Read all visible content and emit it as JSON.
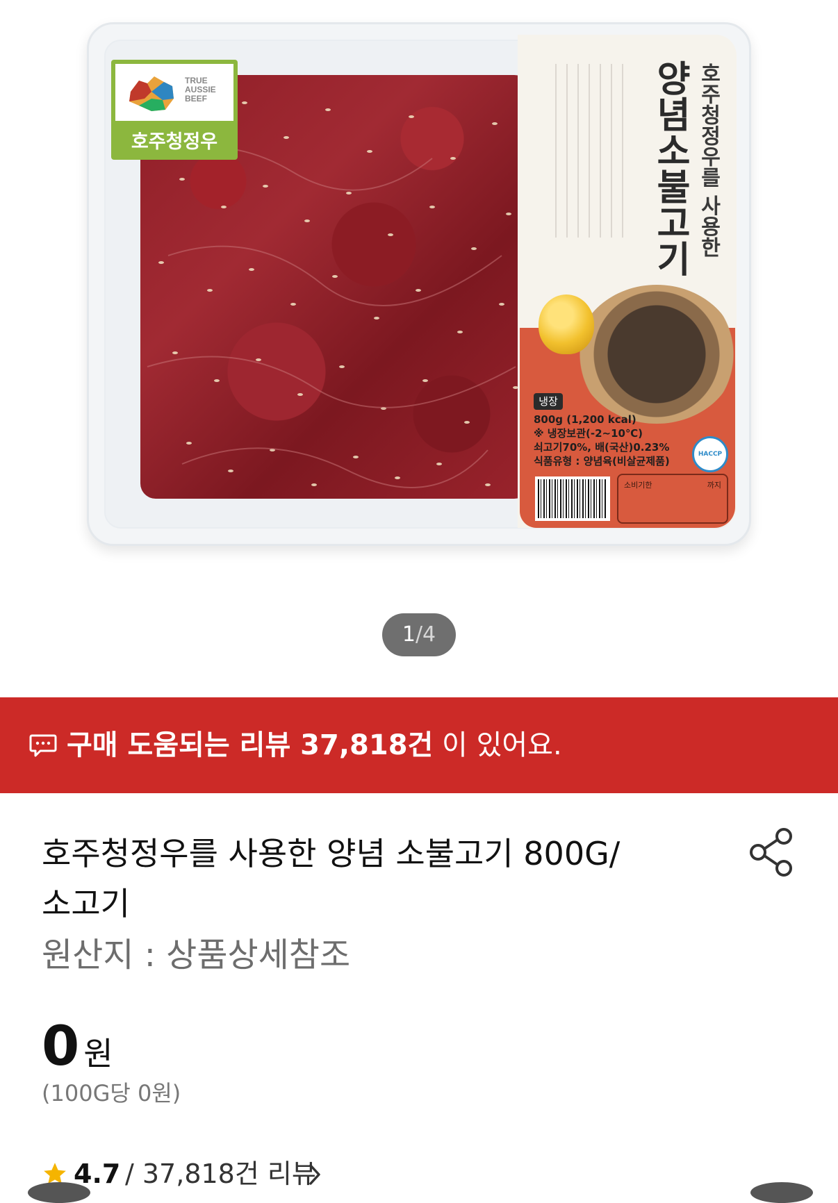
{
  "product_image": {
    "logo_text": "TRUE AUSSIE BEEF",
    "logo_label": "호주청정우",
    "package_title": "양념소불고기",
    "package_subtitle": "호주청정우를 사용한",
    "stock_badge": "냉장",
    "info_lines": [
      "800g (1,200 kcal)",
      "※ 냉장보관(-2~10℃)",
      "쇠고기70%, 배(국산)0.23%",
      "식품유형 : 양념육(비살균제품)"
    ],
    "expiry_label": "소비기한",
    "expiry_until": "까지",
    "haccp": "HACCP",
    "image_index": "1",
    "image_total": "4",
    "image_separator": "/"
  },
  "review_banner": {
    "bold_text": "구매 도움되는 리뷰 37,818건",
    "rest_text": " 이 있어요."
  },
  "product": {
    "title_line1": "호주청정우를 사용한 양념 소불고기 800G/",
    "title_line2": "소고기",
    "origin": "원산지 : 상품상세참조",
    "price": "0",
    "price_unit": "원",
    "unit_price": "(100G당 0원)",
    "rating": "4.7",
    "review_count": "/ 37,818건 리뷰"
  },
  "colors": {
    "banner": "#cc2a27",
    "star": "#f5b400",
    "pager_bg": "#6f6f6f"
  },
  "icons": {
    "banner_icon": "chat-bubble-icon",
    "share": "share-icon",
    "star": "star-icon",
    "chevron": "chevron-right-icon"
  }
}
